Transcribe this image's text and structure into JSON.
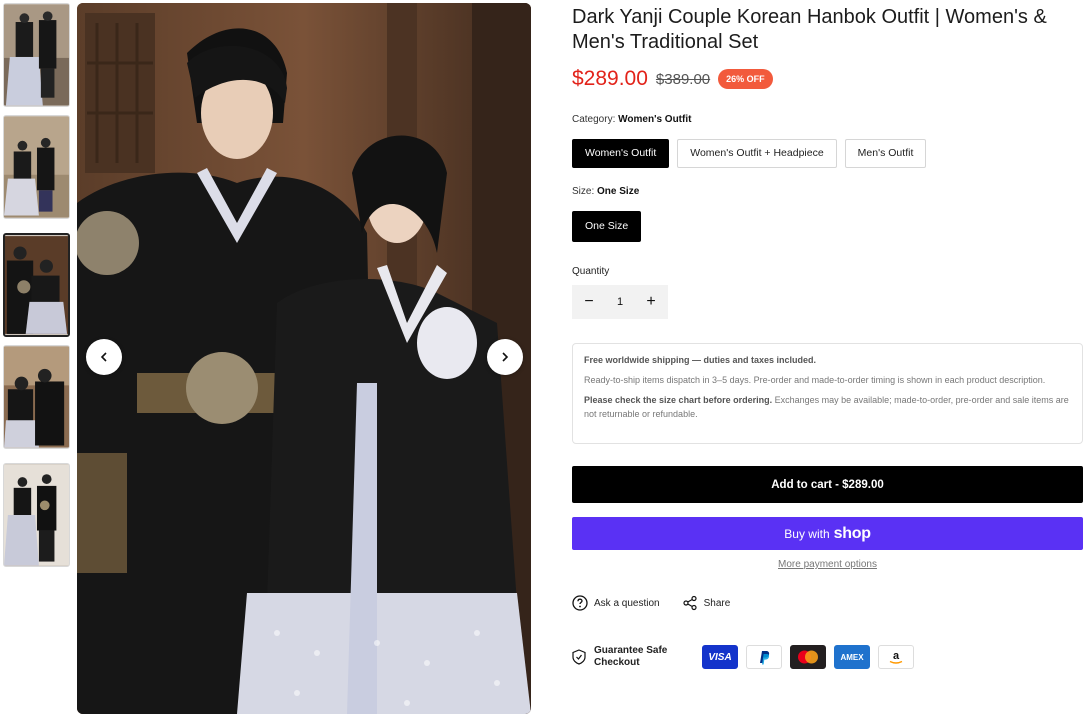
{
  "gallery": {
    "thumbnails": [
      "thumb-1",
      "thumb-2",
      "thumb-3",
      "thumb-4",
      "thumb-5"
    ],
    "active_index": 2,
    "prev_icon": "chevron-left-icon",
    "next_icon": "chevron-right-icon"
  },
  "product": {
    "title": "Dark Yanji Couple Korean Hanbok Outfit | Women's & Men's Traditional Set",
    "price": "$289.00",
    "compare_price": "$389.00",
    "discount_badge": "26% OFF"
  },
  "category": {
    "label": "Category:",
    "selected": "Women's Outfit",
    "options": [
      "Women's Outfit",
      "Women's Outfit + Headpiece",
      "Men's Outfit"
    ]
  },
  "size": {
    "label": "Size:",
    "selected": "One Size",
    "options": [
      "One Size"
    ]
  },
  "quantity": {
    "label": "Quantity",
    "value": "1",
    "minus_icon": "minus-icon",
    "plus_icon": "plus-icon"
  },
  "notice": {
    "shipping_headline": "Free worldwide shipping — duties and taxes included.",
    "dispatch_text": "Ready-to-ship items dispatch in 3–5 days. Pre-order and made-to-order timing is shown in each product description.",
    "size_chart_strong": "Please check the size chart before ordering.",
    "size_chart_rest": " Exchanges may be available; made-to-order, pre-order and sale items are not returnable or refundable."
  },
  "buttons": {
    "add_to_cart": "Add to cart - $289.00",
    "buy_with": "Buy with",
    "shop_word": "shop",
    "more_payment": "More payment options"
  },
  "actions": {
    "ask": "Ask a question",
    "share": "Share"
  },
  "guarantee": {
    "text": "Guarantee Safe Checkout",
    "payment_methods": [
      "VISA",
      "PayPal",
      "Mastercard",
      "AMEX",
      "Amazon"
    ]
  },
  "colors": {
    "price_red": "#e2231a",
    "badge": "#f25a3c",
    "shop_purple": "#5a31f4"
  }
}
